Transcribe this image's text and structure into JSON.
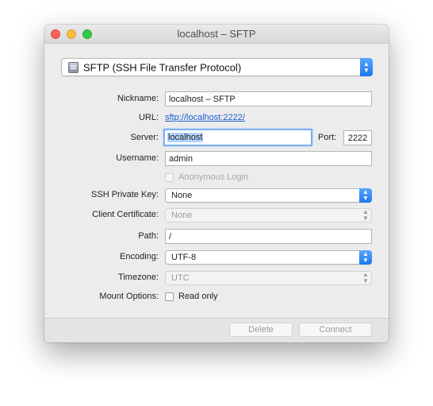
{
  "window": {
    "title": "localhost – SFTP"
  },
  "protocol": {
    "label": "SFTP (SSH File Transfer Protocol)"
  },
  "form": {
    "nickname_label": "Nickname:",
    "nickname_value": "localhost – SFTP",
    "url_label": "URL:",
    "url_value": "sftp://localhost:2222/",
    "server_label": "Server:",
    "server_value": "localhost",
    "port_label": "Port:",
    "port_value": "2222",
    "username_label": "Username:",
    "username_value": "admin",
    "anonymous_label": "Anonymous Login",
    "ssh_key_label": "SSH Private Key:",
    "ssh_key_value": "None",
    "client_cert_label": "Client Certificate:",
    "client_cert_value": "None",
    "path_label": "Path:",
    "path_value": "/",
    "encoding_label": "Encoding:",
    "encoding_value": "UTF-8",
    "timezone_label": "Timezone:",
    "timezone_value": "UTC",
    "mount_label": "Mount Options:",
    "readonly_label": "Read only"
  },
  "buttons": {
    "delete": "Delete",
    "connect": "Connect"
  },
  "colors": {
    "accent": "#1a78f2",
    "selection": "#b3d2fd",
    "link": "#1b5fd0"
  }
}
